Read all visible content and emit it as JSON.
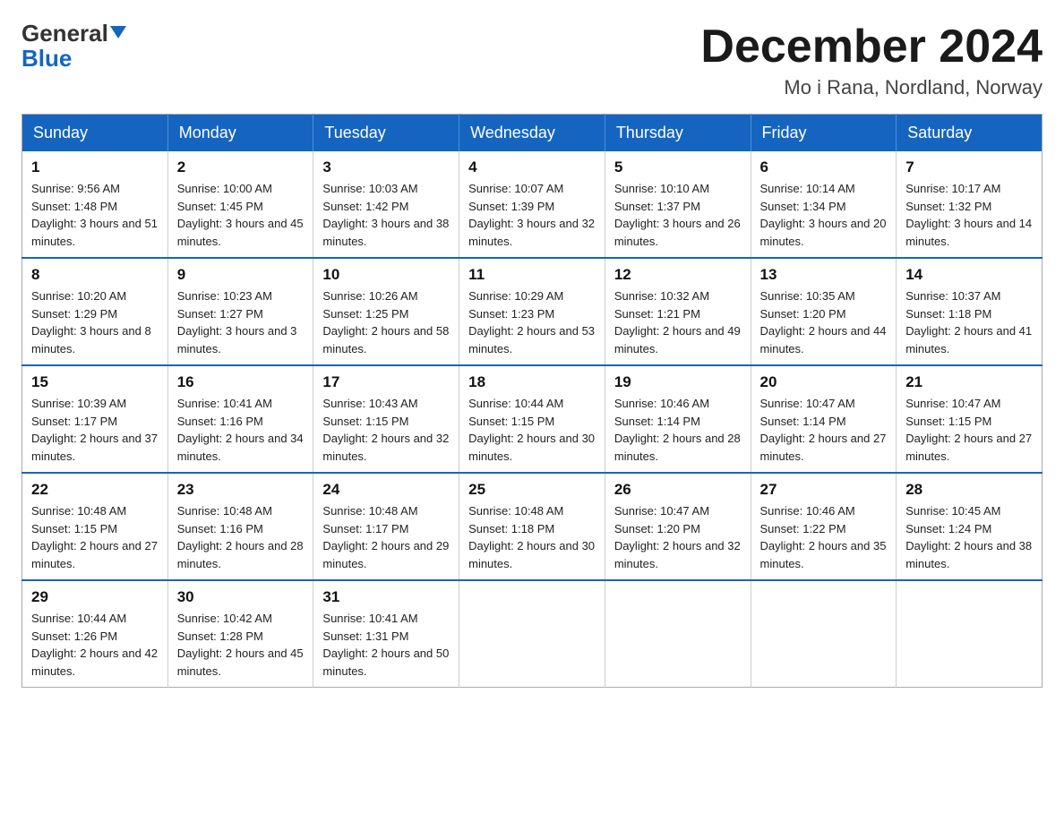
{
  "logo": {
    "general": "General",
    "blue": "Blue",
    "triangle": "▼"
  },
  "header": {
    "month_title": "December 2024",
    "location": "Mo i Rana, Nordland, Norway"
  },
  "weekdays": [
    "Sunday",
    "Monday",
    "Tuesday",
    "Wednesday",
    "Thursday",
    "Friday",
    "Saturday"
  ],
  "weeks": [
    [
      {
        "day": "1",
        "sunrise": "9:56 AM",
        "sunset": "1:48 PM",
        "daylight": "3 hours and 51 minutes."
      },
      {
        "day": "2",
        "sunrise": "10:00 AM",
        "sunset": "1:45 PM",
        "daylight": "3 hours and 45 minutes."
      },
      {
        "day": "3",
        "sunrise": "10:03 AM",
        "sunset": "1:42 PM",
        "daylight": "3 hours and 38 minutes."
      },
      {
        "day": "4",
        "sunrise": "10:07 AM",
        "sunset": "1:39 PM",
        "daylight": "3 hours and 32 minutes."
      },
      {
        "day": "5",
        "sunrise": "10:10 AM",
        "sunset": "1:37 PM",
        "daylight": "3 hours and 26 minutes."
      },
      {
        "day": "6",
        "sunrise": "10:14 AM",
        "sunset": "1:34 PM",
        "daylight": "3 hours and 20 minutes."
      },
      {
        "day": "7",
        "sunrise": "10:17 AM",
        "sunset": "1:32 PM",
        "daylight": "3 hours and 14 minutes."
      }
    ],
    [
      {
        "day": "8",
        "sunrise": "10:20 AM",
        "sunset": "1:29 PM",
        "daylight": "3 hours and 8 minutes."
      },
      {
        "day": "9",
        "sunrise": "10:23 AM",
        "sunset": "1:27 PM",
        "daylight": "3 hours and 3 minutes."
      },
      {
        "day": "10",
        "sunrise": "10:26 AM",
        "sunset": "1:25 PM",
        "daylight": "2 hours and 58 minutes."
      },
      {
        "day": "11",
        "sunrise": "10:29 AM",
        "sunset": "1:23 PM",
        "daylight": "2 hours and 53 minutes."
      },
      {
        "day": "12",
        "sunrise": "10:32 AM",
        "sunset": "1:21 PM",
        "daylight": "2 hours and 49 minutes."
      },
      {
        "day": "13",
        "sunrise": "10:35 AM",
        "sunset": "1:20 PM",
        "daylight": "2 hours and 44 minutes."
      },
      {
        "day": "14",
        "sunrise": "10:37 AM",
        "sunset": "1:18 PM",
        "daylight": "2 hours and 41 minutes."
      }
    ],
    [
      {
        "day": "15",
        "sunrise": "10:39 AM",
        "sunset": "1:17 PM",
        "daylight": "2 hours and 37 minutes."
      },
      {
        "day": "16",
        "sunrise": "10:41 AM",
        "sunset": "1:16 PM",
        "daylight": "2 hours and 34 minutes."
      },
      {
        "day": "17",
        "sunrise": "10:43 AM",
        "sunset": "1:15 PM",
        "daylight": "2 hours and 32 minutes."
      },
      {
        "day": "18",
        "sunrise": "10:44 AM",
        "sunset": "1:15 PM",
        "daylight": "2 hours and 30 minutes."
      },
      {
        "day": "19",
        "sunrise": "10:46 AM",
        "sunset": "1:14 PM",
        "daylight": "2 hours and 28 minutes."
      },
      {
        "day": "20",
        "sunrise": "10:47 AM",
        "sunset": "1:14 PM",
        "daylight": "2 hours and 27 minutes."
      },
      {
        "day": "21",
        "sunrise": "10:47 AM",
        "sunset": "1:15 PM",
        "daylight": "2 hours and 27 minutes."
      }
    ],
    [
      {
        "day": "22",
        "sunrise": "10:48 AM",
        "sunset": "1:15 PM",
        "daylight": "2 hours and 27 minutes."
      },
      {
        "day": "23",
        "sunrise": "10:48 AM",
        "sunset": "1:16 PM",
        "daylight": "2 hours and 28 minutes."
      },
      {
        "day": "24",
        "sunrise": "10:48 AM",
        "sunset": "1:17 PM",
        "daylight": "2 hours and 29 minutes."
      },
      {
        "day": "25",
        "sunrise": "10:48 AM",
        "sunset": "1:18 PM",
        "daylight": "2 hours and 30 minutes."
      },
      {
        "day": "26",
        "sunrise": "10:47 AM",
        "sunset": "1:20 PM",
        "daylight": "2 hours and 32 minutes."
      },
      {
        "day": "27",
        "sunrise": "10:46 AM",
        "sunset": "1:22 PM",
        "daylight": "2 hours and 35 minutes."
      },
      {
        "day": "28",
        "sunrise": "10:45 AM",
        "sunset": "1:24 PM",
        "daylight": "2 hours and 38 minutes."
      }
    ],
    [
      {
        "day": "29",
        "sunrise": "10:44 AM",
        "sunset": "1:26 PM",
        "daylight": "2 hours and 42 minutes."
      },
      {
        "day": "30",
        "sunrise": "10:42 AM",
        "sunset": "1:28 PM",
        "daylight": "2 hours and 45 minutes."
      },
      {
        "day": "31",
        "sunrise": "10:41 AM",
        "sunset": "1:31 PM",
        "daylight": "2 hours and 50 minutes."
      },
      null,
      null,
      null,
      null
    ]
  ]
}
